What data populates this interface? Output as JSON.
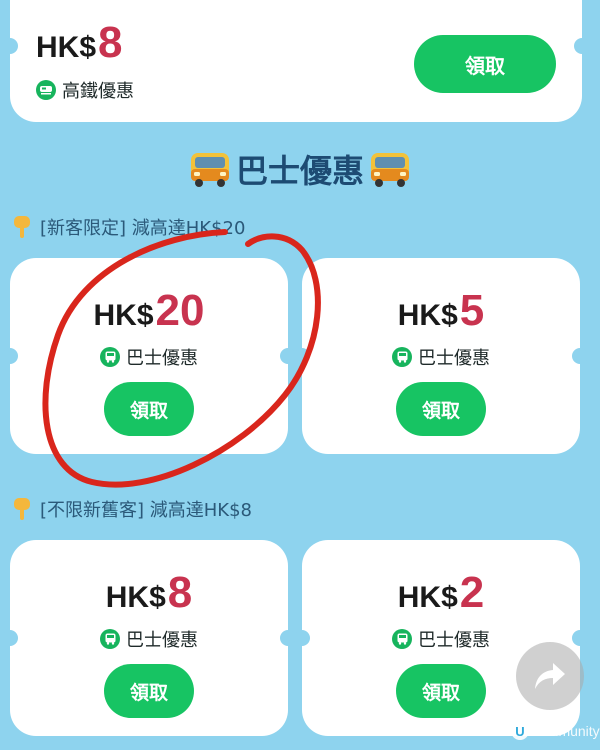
{
  "top_card": {
    "currency": "HK$",
    "amount": "8",
    "tag": "高鐵優惠",
    "tag_icon": "train-icon",
    "button": "領取"
  },
  "section": {
    "title": "巴士優惠",
    "icon": "bus-emoji"
  },
  "promos": [
    {
      "text": "[新客限定] 減高達HK$20",
      "icon": "pointing-down-hand-emoji"
    },
    {
      "text": "[不限新舊客] 減高達HK$8",
      "icon": "pointing-down-hand-emoji"
    }
  ],
  "coupons": [
    {
      "currency": "HK$",
      "amount": "20",
      "tag": "巴士優惠",
      "button": "領取"
    },
    {
      "currency": "HK$",
      "amount": "5",
      "tag": "巴士優惠",
      "button": "領取"
    },
    {
      "currency": "HK$",
      "amount": "8",
      "tag": "巴士優惠",
      "button": "領取"
    },
    {
      "currency": "HK$",
      "amount": "2",
      "tag": "巴士優惠",
      "button": "領取"
    }
  ],
  "watermark": {
    "logo": "U",
    "text": "community"
  },
  "colors": {
    "background": "#8ed3ee",
    "amount": "#c8334f",
    "button": "#17c463",
    "section_title": "#1d4b73",
    "annotation_circle": "#d9261c"
  }
}
